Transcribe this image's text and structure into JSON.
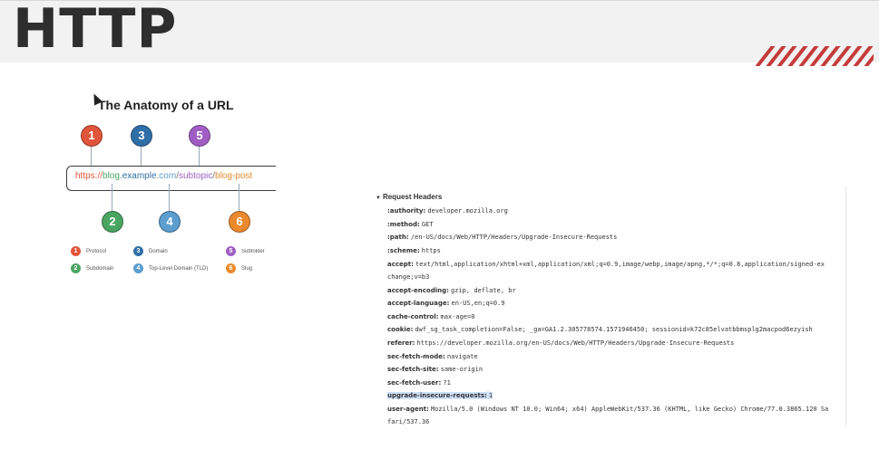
{
  "slide": {
    "title": "HTTP"
  },
  "anatomy": {
    "title": "The Anatomy of a URL",
    "url_parts": [
      {
        "text": "https://",
        "color": "orange"
      },
      {
        "text": "blog",
        "color": "green"
      },
      {
        "text": ".",
        "color": "gray"
      },
      {
        "text": "example",
        "color": "blue"
      },
      {
        "text": ".",
        "color": "gray"
      },
      {
        "text": "com",
        "color": "lblue"
      },
      {
        "text": "/",
        "color": "gray"
      },
      {
        "text": "subtopic",
        "color": "purple"
      },
      {
        "text": "/",
        "color": "gray"
      },
      {
        "text": "blog-post",
        "color": "amber"
      }
    ],
    "top_markers": [
      "1",
      "3",
      "5"
    ],
    "bottom_markers": [
      "2",
      "4",
      "6"
    ],
    "legend": [
      {
        "num": "1",
        "label": "Protocol"
      },
      {
        "num": "3",
        "label": "Domain"
      },
      {
        "num": "5",
        "label": "Subfolder"
      },
      {
        "num": "2",
        "label": "Subdomain"
      },
      {
        "num": "4",
        "label": "Top-Level Domain (TLD)"
      },
      {
        "num": "6",
        "label": "Slug"
      }
    ]
  },
  "colors": {
    "accent_stripes": "#c43b3b",
    "highlight": "#cfe0f7"
  },
  "headers_panel": {
    "title": "Request Headers",
    "rows": [
      {
        "key": ":authority:",
        "value": "developer.mozilla.org"
      },
      {
        "key": ":method:",
        "value": "GET"
      },
      {
        "key": ":path:",
        "value": "/en-US/docs/Web/HTTP/Headers/Upgrade-Insecure-Requests"
      },
      {
        "key": ":scheme:",
        "value": "https"
      },
      {
        "key": "accept:",
        "value": "text/html,application/xhtml+xml,application/xml;q=0.9,image/webp,image/apng,*/*;q=0.8,application/signed-ex"
      },
      {
        "key": "",
        "value": "change;v=b3"
      },
      {
        "key": "accept-encoding:",
        "value": "gzip, deflate, br"
      },
      {
        "key": "accept-language:",
        "value": "en-US,en;q=0.9"
      },
      {
        "key": "cache-control:",
        "value": "max-age=0"
      },
      {
        "key": "cookie:",
        "value": "dwf_sg_task_completion=False; _ga=GA1.2.305778574.1571946450; sessionid=k72c85elvatbbmsplg2macpod6ezyish"
      },
      {
        "key": "referer:",
        "value": "https://developer.mozilla.org/en-US/docs/Web/HTTP/Headers/Upgrade-Insecure-Requests"
      },
      {
        "key": "sec-fetch-mode:",
        "value": "navigate"
      },
      {
        "key": "sec-fetch-site:",
        "value": "same-origin"
      },
      {
        "key": "sec-fetch-user:",
        "value": "?1"
      },
      {
        "key": "upgrade-insecure-requests:",
        "value": "1"
      },
      {
        "key": "user-agent:",
        "value": "Mozilla/5.0 (Windows NT 10.0; Win64; x64) AppleWebKit/537.36 (KHTML, like Gecko) Chrome/77.0.3865.120 Sa"
      },
      {
        "key": "",
        "value": "fari/537.36"
      }
    ]
  }
}
